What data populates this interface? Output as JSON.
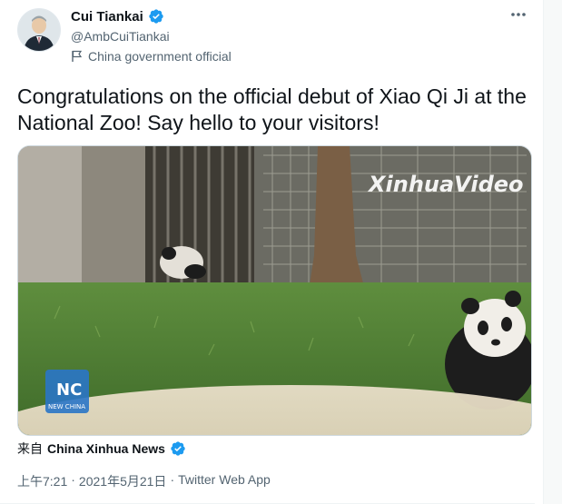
{
  "author": {
    "display_name": "Cui Tiankai",
    "handle": "@AmbCuiTiankai",
    "account_label": "China government official"
  },
  "tweet": {
    "text": "Congratulations on the official debut of Xiao Qi Ji at the National Zoo! Say hello to your visitors!"
  },
  "media": {
    "watermark": "XinhuaVideo",
    "logo_text": "NC",
    "logo_subtext": "NEW CHINA"
  },
  "source": {
    "prefix": "来自",
    "name": "China Xinhua News"
  },
  "meta": {
    "time": "上午7:21",
    "sep1": "·",
    "date": "2021年5月21日",
    "sep2": "·",
    "client": "Twitter Web App"
  },
  "colors": {
    "verified": "#1d9bf0",
    "text_secondary": "#536471",
    "text_primary": "#0f1419"
  },
  "icons": {
    "verified": "verified-badge-icon",
    "flag": "flag-icon",
    "more": "more-icon"
  }
}
